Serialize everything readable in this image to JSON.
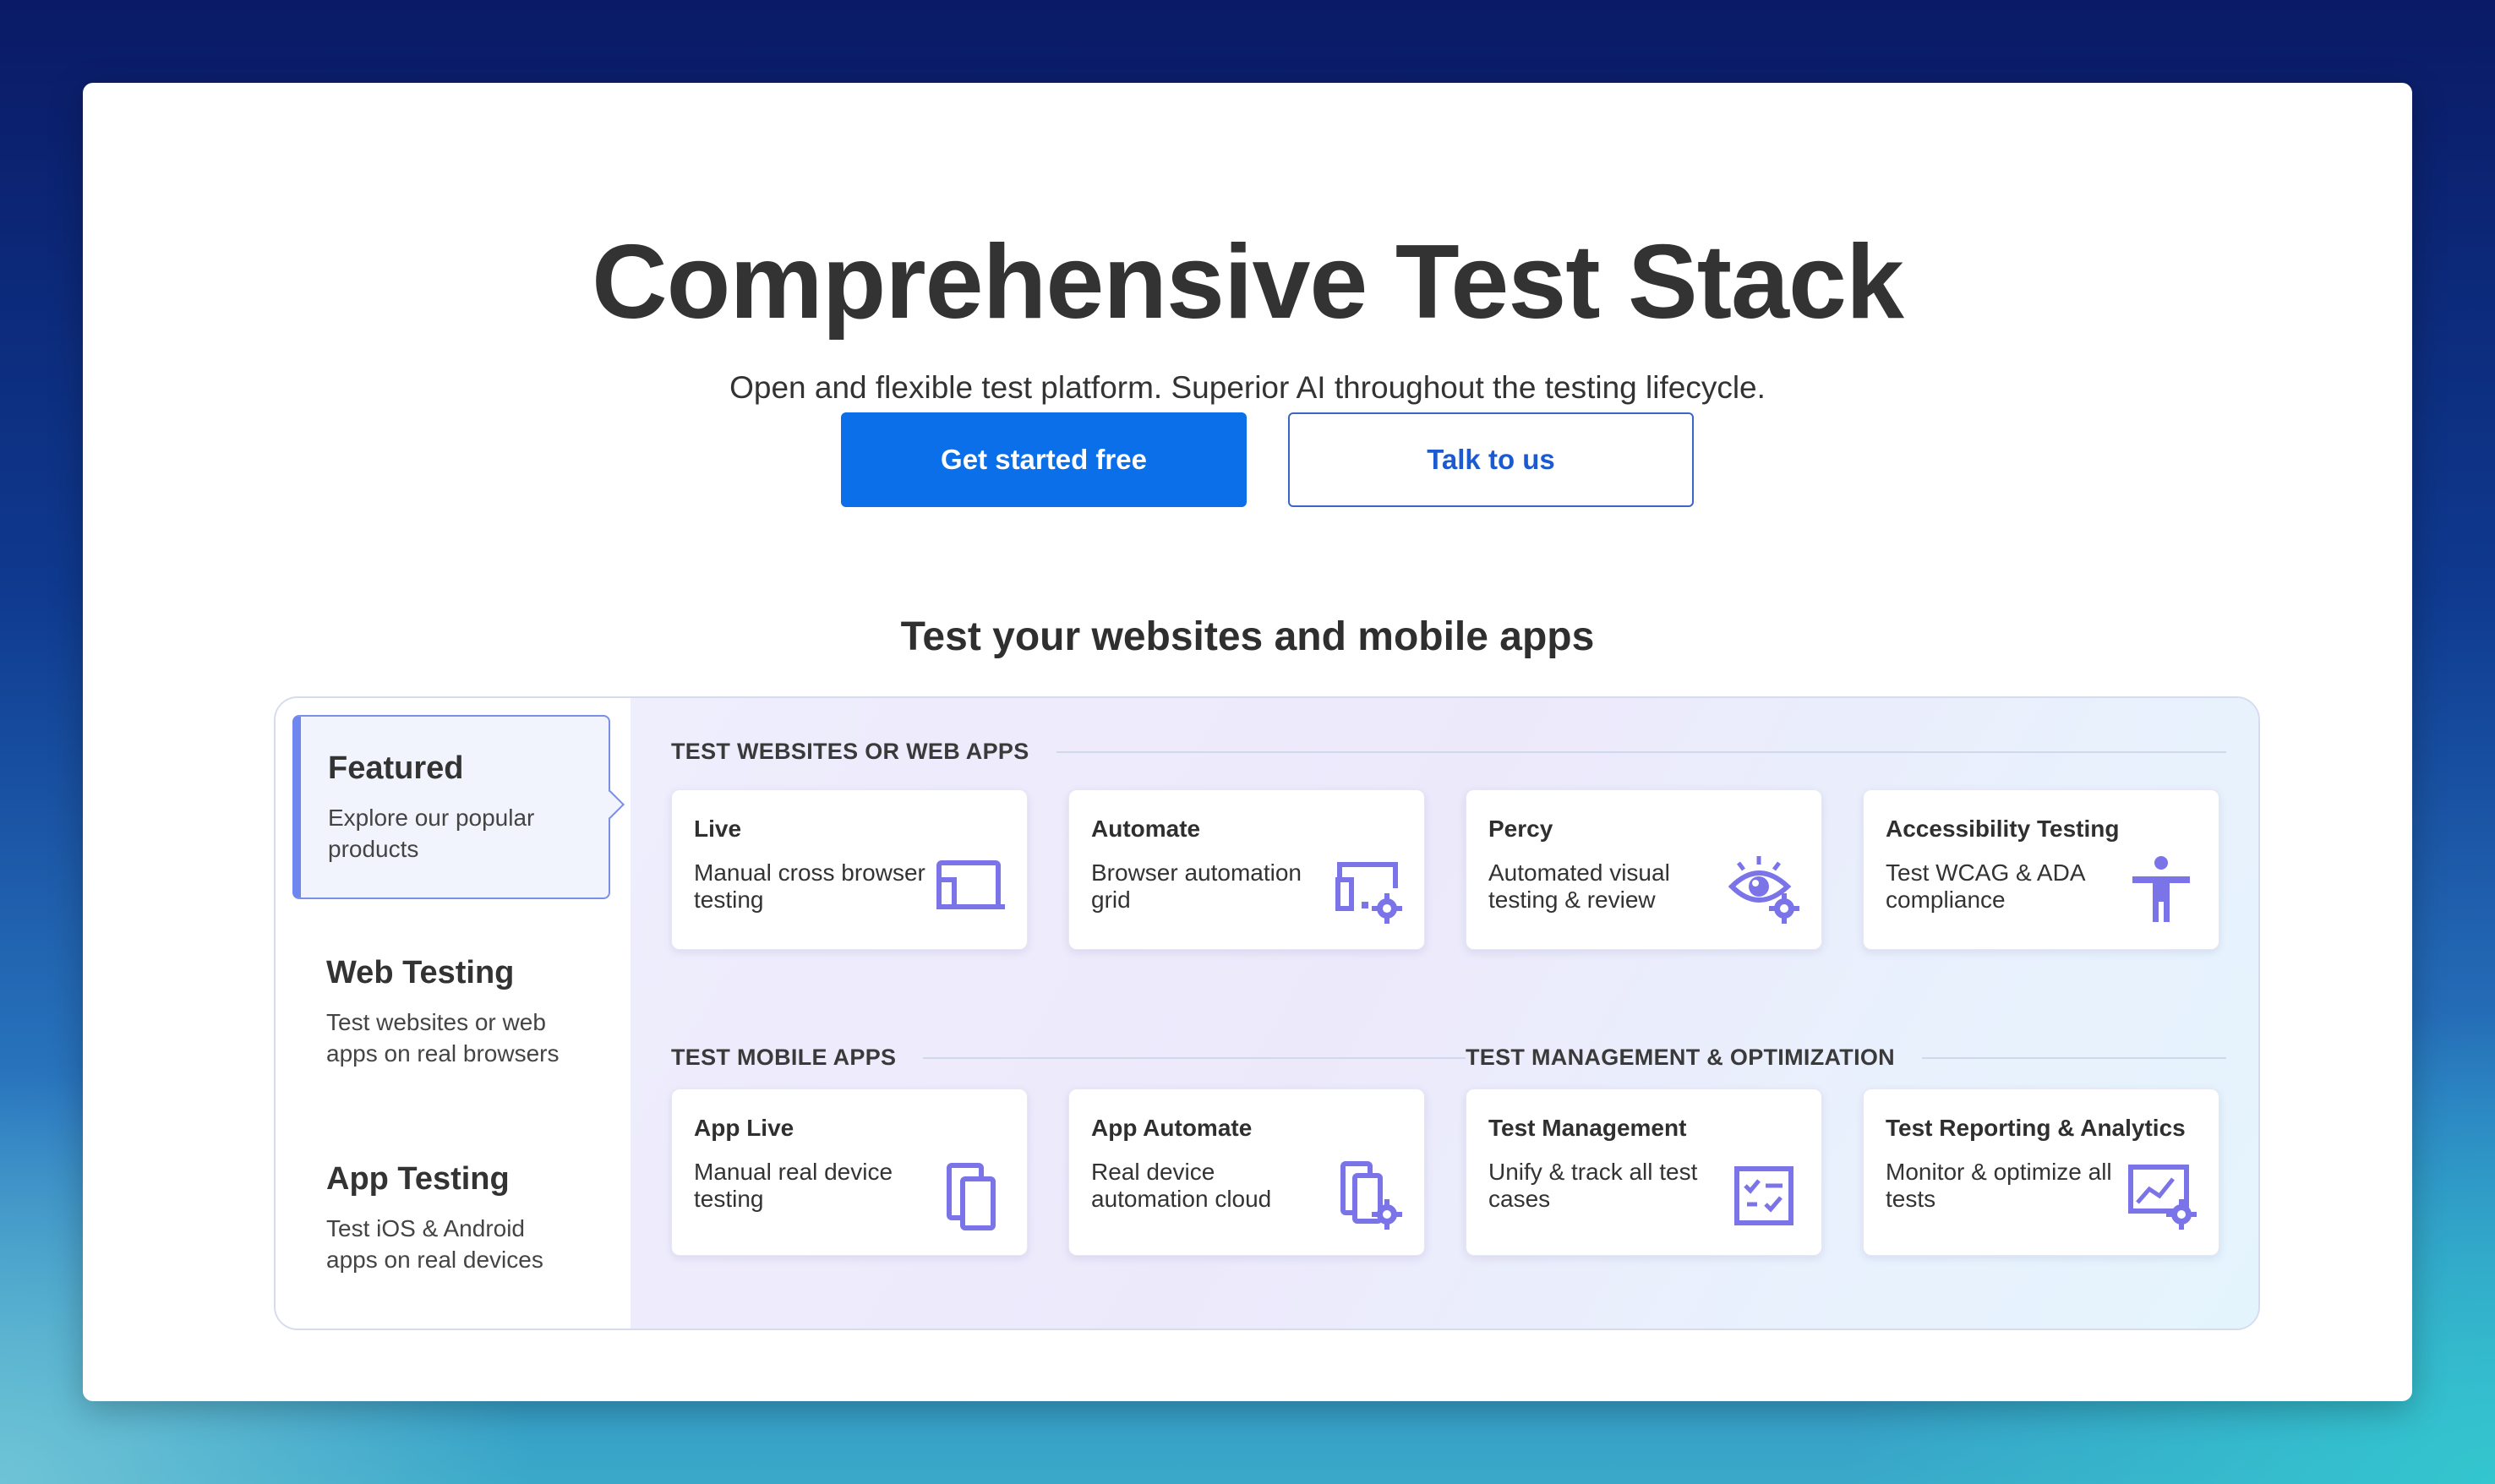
{
  "hero": {
    "title": "Comprehensive Test Stack",
    "subtitle": "Open and flexible test platform. Superior AI throughout the testing lifecycle.",
    "primary_button": "Get started free",
    "secondary_button": "Talk to us"
  },
  "section": {
    "title": "Test your websites and mobile apps"
  },
  "nav": [
    {
      "title": "Featured",
      "desc": "Explore our popular products"
    },
    {
      "title": "Web Testing",
      "desc": "Test websites or web apps on real browsers"
    },
    {
      "title": "App Testing",
      "desc": "Test iOS & Android apps on real devices"
    }
  ],
  "groups": {
    "web": "TEST WEBSITES OR WEB APPS",
    "mobile": "TEST MOBILE APPS",
    "management": "TEST MANAGEMENT & OPTIMIZATION"
  },
  "tiles": [
    {
      "title": "Live",
      "desc": "Manual cross browser testing",
      "icon": "browser-window-icon"
    },
    {
      "title": "Automate",
      "desc": "Browser automation grid",
      "icon": "browser-gear-icon"
    },
    {
      "title": "Percy",
      "desc": "Automated visual testing & review",
      "icon": "eye-gear-icon"
    },
    {
      "title": "Accessibility Testing",
      "desc": "Test WCAG & ADA compliance",
      "icon": "accessibility-icon"
    },
    {
      "title": "App Live",
      "desc": "Manual real device testing",
      "icon": "devices-icon"
    },
    {
      "title": "App Automate",
      "desc": "Real device automation cloud",
      "icon": "devices-gear-icon"
    },
    {
      "title": "Test Management",
      "desc": "Unify & track all test cases",
      "icon": "checklist-icon"
    },
    {
      "title": "Test Reporting & Analytics",
      "desc": "Monitor & optimize all tests",
      "icon": "analytics-icon"
    }
  ],
  "colors": {
    "accent": "#0a6fe8",
    "icon": "#7b74e8",
    "nav_active_border": "#6f86ef"
  }
}
